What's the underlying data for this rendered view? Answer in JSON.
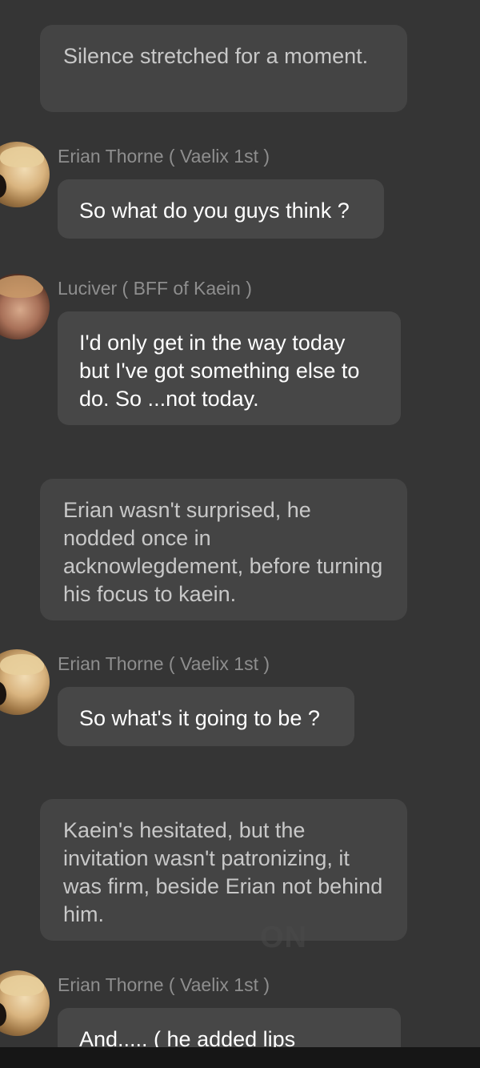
{
  "messages": [
    {
      "type": "narration",
      "text": "Silence stretched for a moment."
    },
    {
      "type": "character",
      "sender": "Erian Thorne ( Vaelix 1st )",
      "avatar": "erian-avatar",
      "text": "So what do you guys think ?"
    },
    {
      "type": "character",
      "sender": "Luciver ( BFF of Kaein )",
      "avatar": "luciver-avatar",
      "text": "I'd only get in the way today but I've got something else to do. So ...not today."
    },
    {
      "type": "narration",
      "text": "Erian wasn't surprised, he nodded once in acknowlegdement, before turning his focus to kaein."
    },
    {
      "type": "character",
      "sender": "Erian Thorne ( Vaelix 1st )",
      "avatar": "erian-avatar",
      "text": "So what's it going to be ?"
    },
    {
      "type": "narration",
      "text": "Kaein's hesitated, but the invitation wasn't patronizing, it was firm, beside Erian not behind him."
    },
    {
      "type": "character",
      "sender": "Erian Thorne ( Vaelix 1st )",
      "avatar": "erian-avatar",
      "text": "And..... ( he added lips"
    }
  ],
  "watermark": "WATTPAD ON"
}
